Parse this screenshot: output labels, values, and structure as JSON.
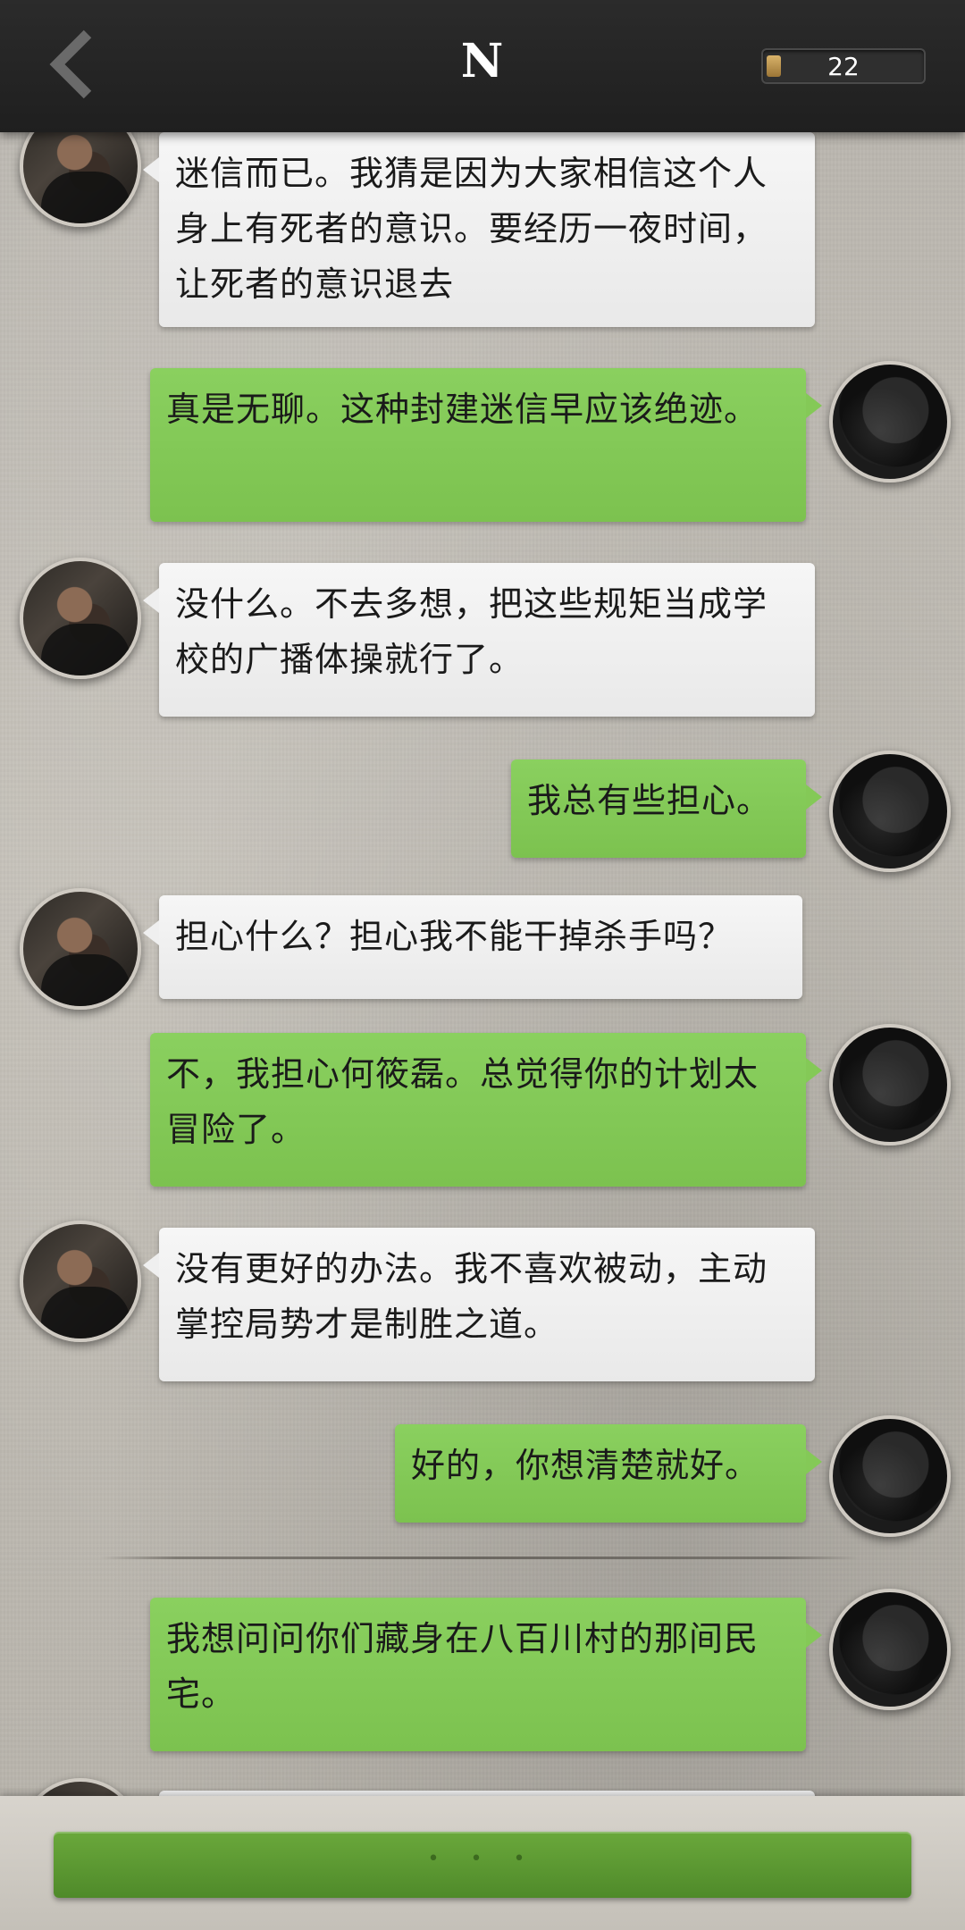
{
  "header": {
    "title": "N",
    "counter": "22",
    "back_icon": "chevron-left-icon"
  },
  "messages": [
    {
      "sender": "other",
      "text": "迷信而已。我猜是因为大家相信这个人身上有死者的意识。要经历一夜时间，让死者的意识退去"
    },
    {
      "sender": "self",
      "text": "真是无聊。这种封建迷信早应该绝迹。"
    },
    {
      "sender": "other",
      "text": "没什么。不去多想，把这些规矩当成学校的广播体操就行了。"
    },
    {
      "sender": "self",
      "text": "我总有些担心。"
    },
    {
      "sender": "other",
      "text": "担心什么？担心我不能干掉杀手吗？"
    },
    {
      "sender": "self",
      "text": "不，我担心何筱磊。总觉得你的计划太冒险了。"
    },
    {
      "sender": "other",
      "text": "没有更好的办法。我不喜欢被动，主动掌控局势才是制胜之道。"
    },
    {
      "sender": "self",
      "text": "好的，你想清楚就好。"
    },
    {
      "sender": "self",
      "text": "我想问问你们藏身在八百川村的那间民宅。"
    }
  ],
  "bottom": {
    "typing_indicator": "• • •"
  },
  "colors": {
    "self_bubble": "#84c957",
    "other_bubble": "#efefef",
    "header_bg": "#242424",
    "bottom_button": "#5d9a32"
  }
}
